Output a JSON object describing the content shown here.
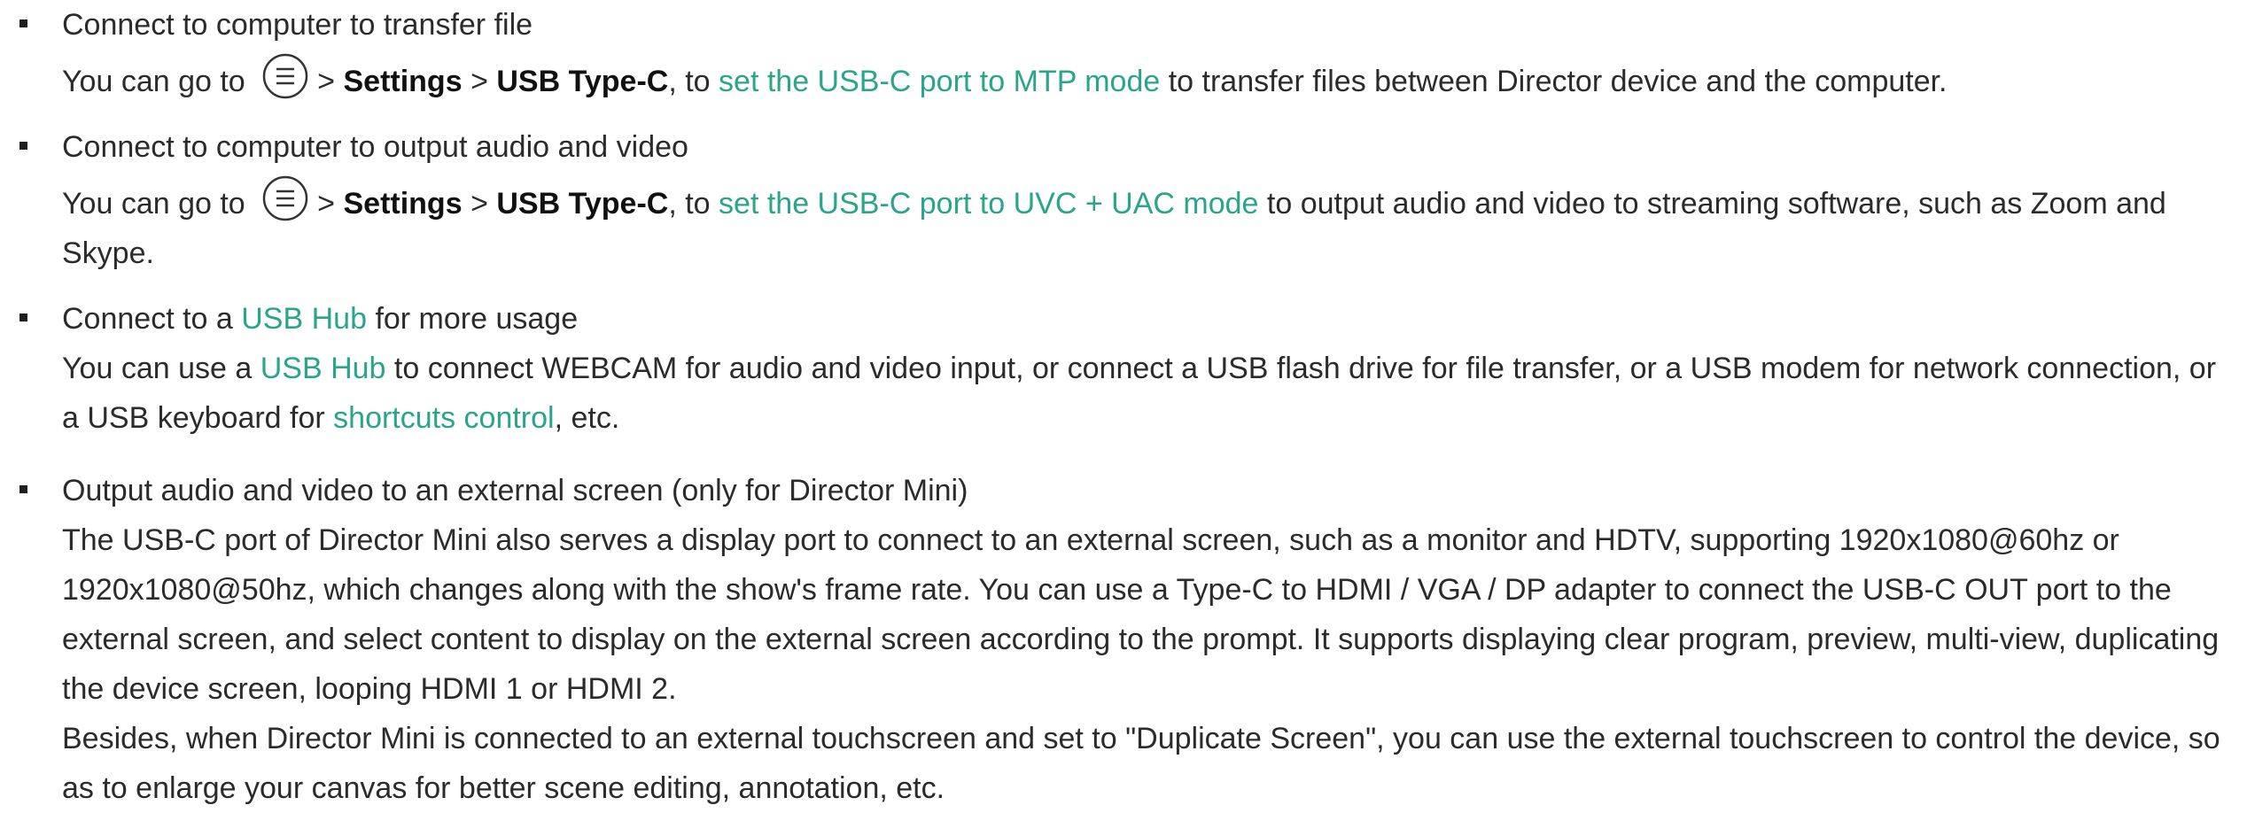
{
  "items": [
    {
      "heading": "Connect to computer to transfer file",
      "prefix": "You can go to",
      "sep1": ">",
      "settings": "Settings",
      "sep2": ">",
      "usb_type_c": "USB Type-C",
      "to": ", to",
      "link": "set the USB-C port to MTP mode",
      "suffix": "to transfer files between Director device and the computer."
    },
    {
      "heading": "Connect to computer to output audio and video",
      "prefix": "You can go to",
      "sep1": ">",
      "settings": "Settings",
      "sep2": ">",
      "usb_type_c": "USB Type-C",
      "to": ", to",
      "link": "set the USB-C port to UVC + UAC mode",
      "suffix": "to output audio and video to streaming software, such as Zoom and Skype."
    },
    {
      "heading_pre": "Connect to a",
      "heading_link": "USB Hub",
      "heading_post": "for more usage",
      "body_pre": "You can use a",
      "body_link": "USB Hub",
      "body_mid": "to connect WEBCAM for audio and video input, or connect a USB flash drive for file transfer, or a USB modem for network connection, or a USB keyboard for",
      "body_link2": "shortcuts control",
      "body_post": ", etc."
    },
    {
      "heading": "Output audio and video to an external screen (only for Director Mini)",
      "para1": "The USB-C port of Director Mini also serves a display port to connect to an external screen, such as a monitor and HDTV, supporting 1920x1080@60hz or 1920x1080@50hz, which changes along with the show's frame rate. You can use a Type-C to HDMI / VGA / DP adapter to connect the USB-C OUT port to the external screen, and select content to display on the external screen according to the prompt. It supports displaying clear program, preview, multi-view, duplicating the device screen, looping HDMI 1 or HDMI 2.",
      "para2": "Besides, when Director Mini is connected to an external touchscreen and set to \"Duplicate Screen\", you can use the external touchscreen to control the device, so as to enlarge your canvas for better scene editing, annotation, etc."
    }
  ],
  "icons": {
    "menu": "menu-icon"
  },
  "colors": {
    "link": "#2aa58a",
    "text": "#2b2b2b"
  }
}
